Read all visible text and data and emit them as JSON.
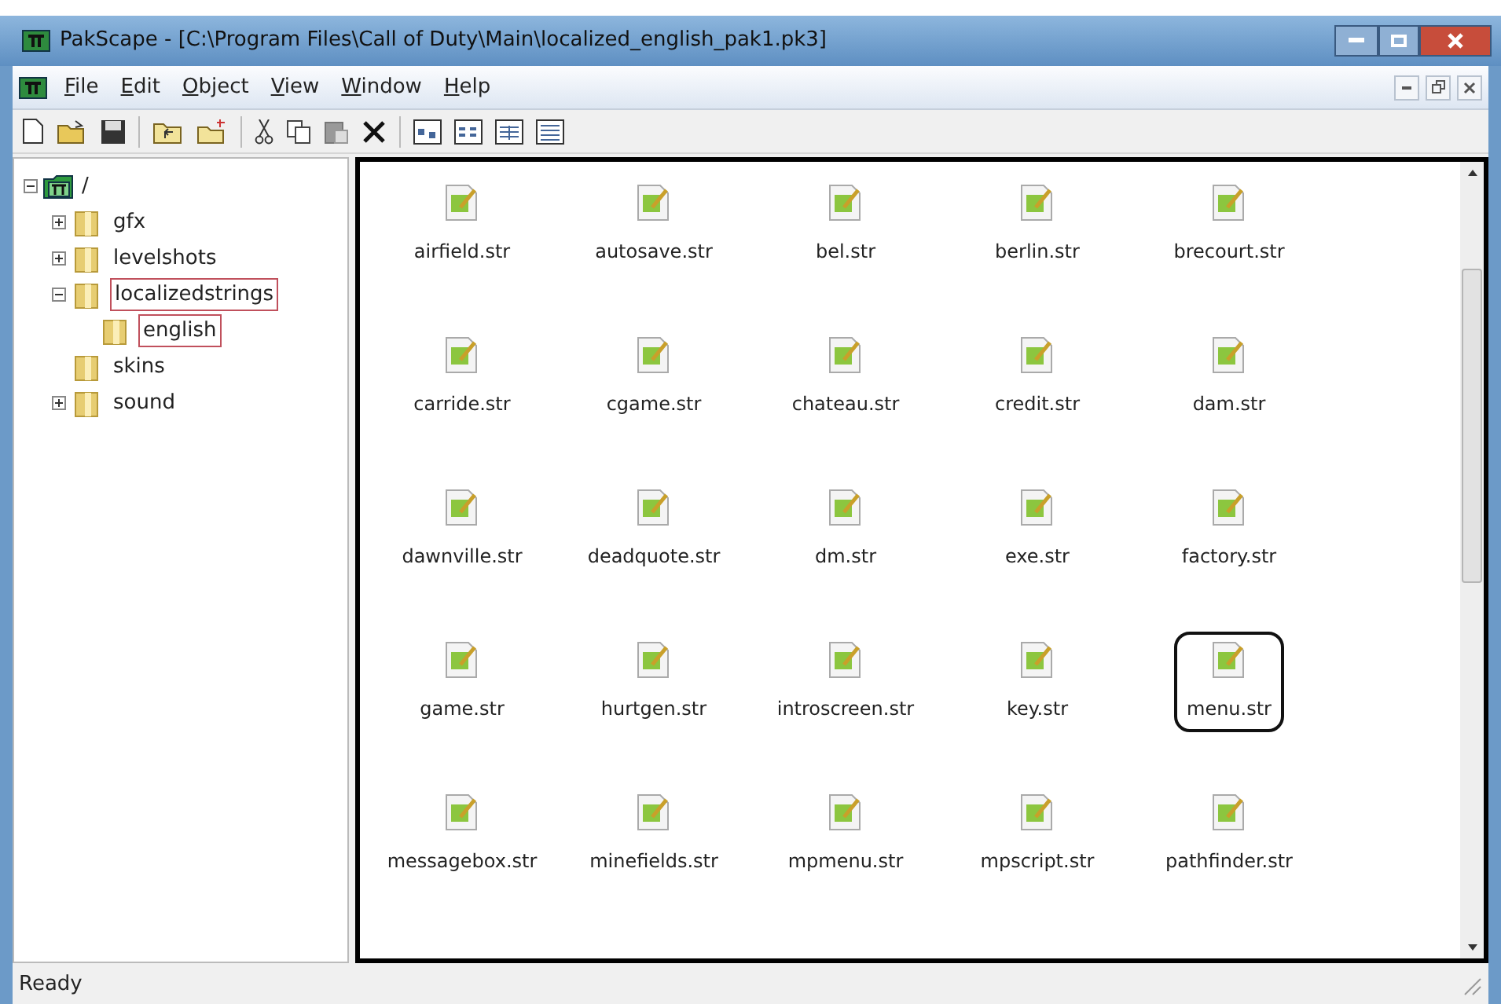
{
  "window": {
    "title": "PakScape - [C:\\Program Files\\Call of Duty\\Main\\localized_english_pak1.pk3]"
  },
  "menu": [
    {
      "label": "File"
    },
    {
      "label": "Edit"
    },
    {
      "label": "Object"
    },
    {
      "label": "View"
    },
    {
      "label": "Window"
    },
    {
      "label": "Help"
    }
  ],
  "tree": [
    {
      "label": "/",
      "kind": "root",
      "expanded": true,
      "highlighted": false,
      "children": [
        {
          "label": "gfx",
          "kind": "folder",
          "expanded": false,
          "highlighted": false
        },
        {
          "label": "levelshots",
          "kind": "folder",
          "expanded": false,
          "highlighted": false
        },
        {
          "label": "localizedstrings",
          "kind": "folder",
          "expanded": true,
          "highlighted": true,
          "children": [
            {
              "label": "english",
              "kind": "folder",
              "highlighted": true
            }
          ]
        },
        {
          "label": "skins",
          "kind": "folder",
          "highlighted": false
        },
        {
          "label": "sound",
          "kind": "folder",
          "expanded": false,
          "highlighted": false
        }
      ]
    }
  ],
  "files": [
    {
      "name": "airfield.str",
      "highlighted": false
    },
    {
      "name": "autosave.str",
      "highlighted": false
    },
    {
      "name": "bel.str",
      "highlighted": false
    },
    {
      "name": "berlin.str",
      "highlighted": false
    },
    {
      "name": "brecourt.str",
      "highlighted": false
    },
    {
      "name": "carride.str",
      "highlighted": false
    },
    {
      "name": "cgame.str",
      "highlighted": false
    },
    {
      "name": "chateau.str",
      "highlighted": false
    },
    {
      "name": "credit.str",
      "highlighted": false
    },
    {
      "name": "dam.str",
      "highlighted": false
    },
    {
      "name": "dawnville.str",
      "highlighted": false
    },
    {
      "name": "deadquote.str",
      "highlighted": false
    },
    {
      "name": "dm.str",
      "highlighted": false
    },
    {
      "name": "exe.str",
      "highlighted": false
    },
    {
      "name": "factory.str",
      "highlighted": false
    },
    {
      "name": "game.str",
      "highlighted": false
    },
    {
      "name": "hurtgen.str",
      "highlighted": false
    },
    {
      "name": "introscreen.str",
      "highlighted": false
    },
    {
      "name": "key.str",
      "highlighted": false
    },
    {
      "name": "menu.str",
      "highlighted": true
    },
    {
      "name": "messagebox.str",
      "highlighted": false
    },
    {
      "name": "minefields.str",
      "highlighted": false
    },
    {
      "name": "mpmenu.str",
      "highlighted": false
    },
    {
      "name": "mpscript.str",
      "highlighted": false
    },
    {
      "name": "pathfinder.str",
      "highlighted": false
    }
  ],
  "status_bar": "Ready"
}
